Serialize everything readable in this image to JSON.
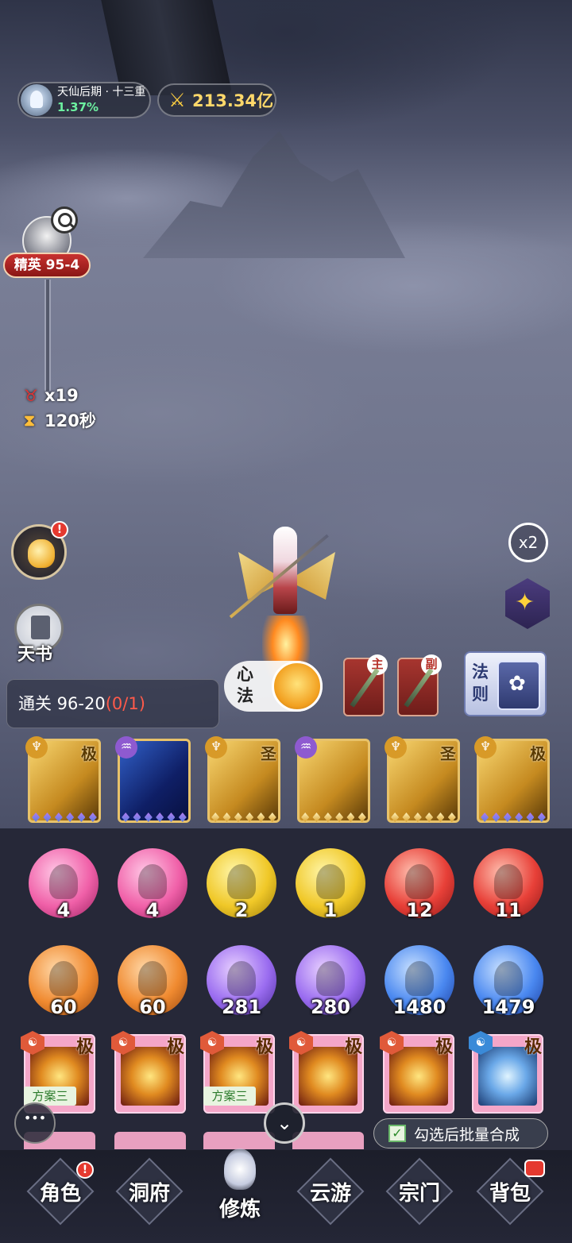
{
  "hud": {
    "realm": "天仙后期 · 十三重",
    "progress": "1.37%",
    "power": "213.34亿"
  },
  "stage": {
    "badge": "精英 95-4",
    "enemies": "x19",
    "timer": "120秒"
  },
  "side": {
    "bag_alert": "!",
    "book_label": "天书",
    "speed": "x2"
  },
  "quest": {
    "prefix": "通关 96-20",
    "count": "(0/1)"
  },
  "mind": {
    "label": "心法"
  },
  "weapons": [
    {
      "tag": "主"
    },
    {
      "tag": "副"
    }
  ],
  "rules": {
    "label": "法则"
  },
  "skills": [
    {
      "grade": "极",
      "cls": "♆",
      "style": "gold"
    },
    {
      "grade": "",
      "cls": "♒",
      "style": "blue"
    },
    {
      "grade": "圣",
      "cls": "♆",
      "style": "gold"
    },
    {
      "grade": "",
      "cls": "♒",
      "style": "gold"
    },
    {
      "grade": "圣",
      "cls": "♆",
      "style": "gold"
    },
    {
      "grade": "极",
      "cls": "♆",
      "style": "gold"
    }
  ],
  "pills_row1": [
    "4",
    "4",
    "2",
    "1",
    "12",
    "11"
  ],
  "pills_row2": [
    "60",
    "60",
    "281",
    "280",
    "1480",
    "1479"
  ],
  "equipment": [
    {
      "grade": "极",
      "plan": "方案三"
    },
    {
      "grade": "极",
      "plan": ""
    },
    {
      "grade": "极",
      "plan": "方案三"
    },
    {
      "grade": "极",
      "plan": ""
    },
    {
      "grade": "极",
      "plan": ""
    },
    {
      "grade": "极",
      "plan": ""
    }
  ],
  "batch_label": "勾选后批量合成",
  "nav": {
    "role": "角色",
    "cave": "洞府",
    "cultivate": "修炼",
    "travel": "云游",
    "sect": "宗门",
    "bag": "背包",
    "alert": "!"
  }
}
